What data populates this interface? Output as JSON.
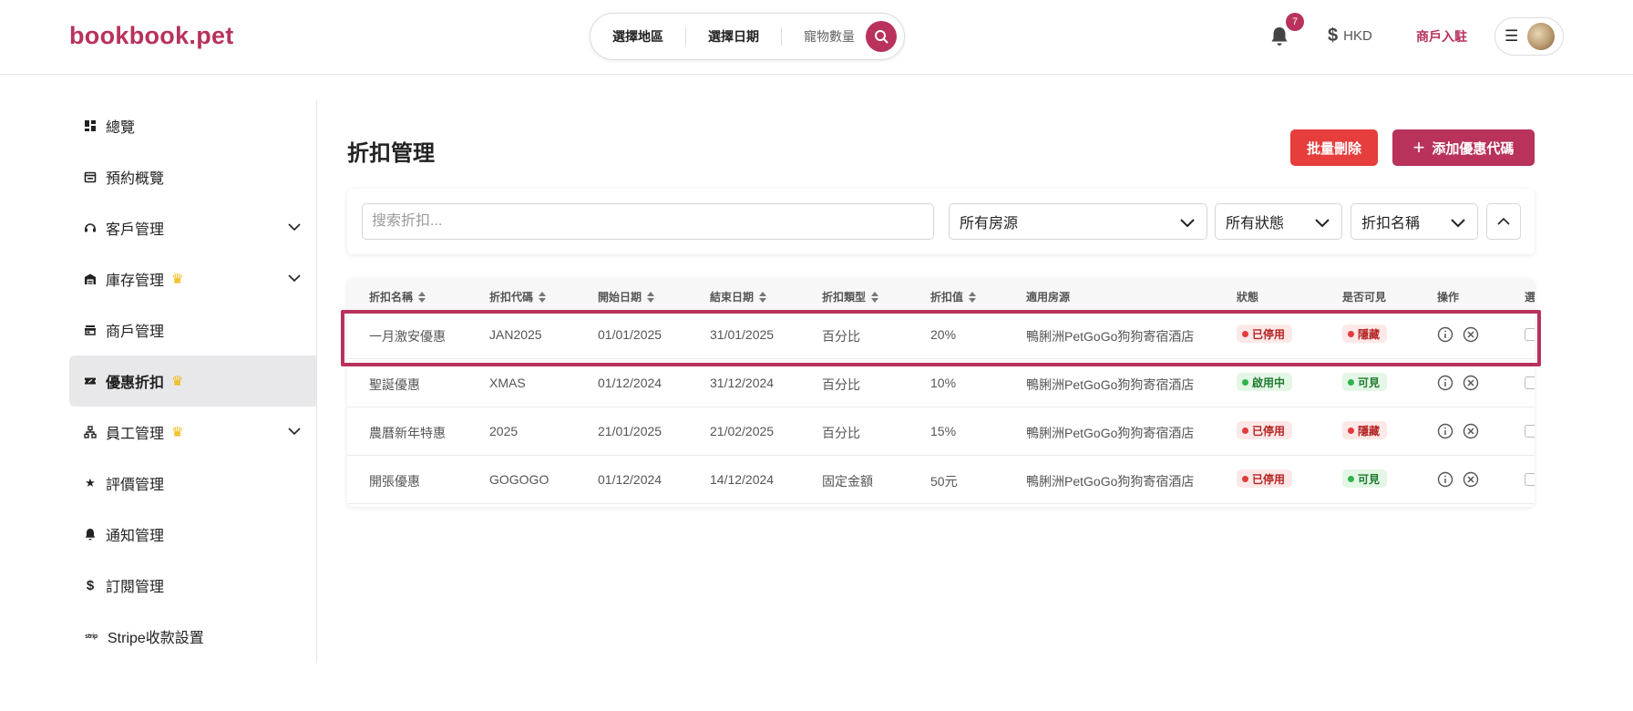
{
  "header": {
    "logo": "bookbook.pet",
    "search_region": "選擇地區",
    "search_date": "選擇日期",
    "search_pets": "寵物數量",
    "notification_count": "7",
    "currency": "HKD",
    "merchant_link": "商戶入駐"
  },
  "sidebar": {
    "items": [
      {
        "label": "總覽",
        "icon": "dashboard-icon"
      },
      {
        "label": "預約概覽",
        "icon": "calendar-icon"
      },
      {
        "label": "客戶管理",
        "icon": "headset-icon"
      },
      {
        "label": "庫存管理",
        "icon": "warehouse-icon"
      },
      {
        "label": "商戶管理",
        "icon": "store-icon"
      },
      {
        "label": "優惠折扣",
        "icon": "ticket-icon"
      },
      {
        "label": "員工管理",
        "icon": "sitemap-icon"
      },
      {
        "label": "評價管理",
        "icon": "star-icon"
      },
      {
        "label": "通知管理",
        "icon": "bell-icon"
      },
      {
        "label": "訂閱管理",
        "icon": "dollar-icon"
      },
      {
        "label": "Stripe收款設置",
        "icon": "stripe-icon"
      }
    ]
  },
  "main": {
    "title": "折扣管理",
    "bulk_delete": "批量刪除",
    "add_code": "添加優惠代碼"
  },
  "filters": {
    "search_placeholder": "搜索折扣...",
    "property": "所有房源",
    "status": "所有狀態",
    "sort_by": "折扣名稱"
  },
  "table": {
    "headers": [
      "折扣名稱",
      "折扣代碼",
      "開始日期",
      "結束日期",
      "折扣類型",
      "折扣值",
      "適用房源",
      "狀態",
      "是否可見",
      "操作",
      "選"
    ],
    "rows": [
      {
        "name": "一月激安優惠",
        "code": "JAN2025",
        "start": "01/01/2025",
        "end": "31/01/2025",
        "type": "百分比",
        "value": "20%",
        "property": "鴨脷洲PetGoGo狗狗寄宿酒店",
        "status": "已停用",
        "status_color": "#e23b3b",
        "visibility": "隱藏",
        "visibility_color": "#e23b3b"
      },
      {
        "name": "聖誕優惠",
        "code": "XMAS",
        "start": "01/12/2024",
        "end": "31/12/2024",
        "type": "百分比",
        "value": "10%",
        "property": "鴨脷洲PetGoGo狗狗寄宿酒店",
        "status": "啟用中",
        "status_color": "#2fb34a",
        "visibility": "可見",
        "visibility_color": "#2fb34a"
      },
      {
        "name": "農曆新年特惠",
        "code": "2025",
        "start": "21/01/2025",
        "end": "21/02/2025",
        "type": "百分比",
        "value": "15%",
        "property": "鴨脷洲PetGoGo狗狗寄宿酒店",
        "status": "已停用",
        "status_color": "#e23b3b",
        "visibility": "隱藏",
        "visibility_color": "#e23b3b"
      },
      {
        "name": "開張優惠",
        "code": "GOGOGO",
        "start": "01/12/2024",
        "end": "14/12/2024",
        "type": "固定金額",
        "value": "50元",
        "property": "鴨脷洲PetGoGo狗狗寄宿酒店",
        "status": "已停用",
        "status_color": "#e23b3b",
        "visibility": "可見",
        "visibility_color": "#2fb34a"
      }
    ]
  },
  "colors": {
    "brand": "#b8325c",
    "danger": "#e63d3d",
    "crown": "#f2b400"
  }
}
